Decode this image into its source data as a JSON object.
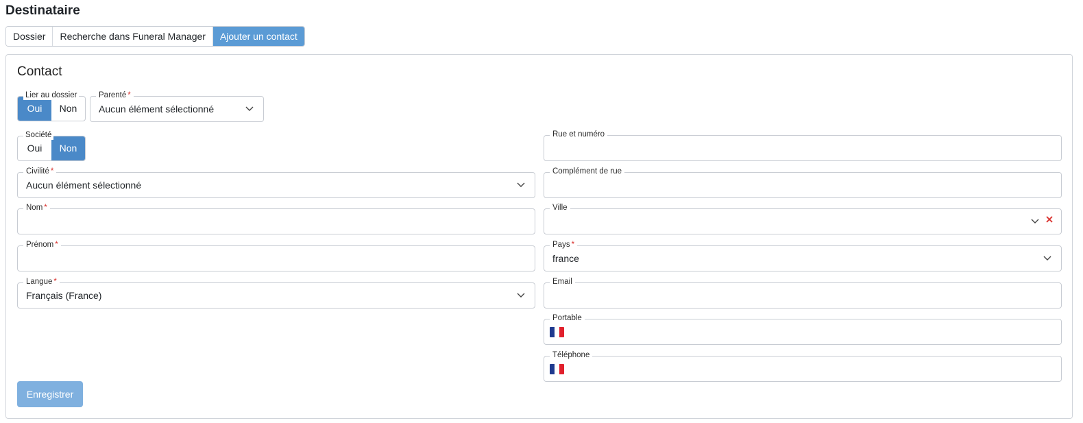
{
  "page": {
    "heading": "Destinataire"
  },
  "tabs": [
    {
      "label": "Dossier",
      "active": false
    },
    {
      "label": "Recherche dans Funeral Manager",
      "active": false
    },
    {
      "label": "Ajouter un contact",
      "active": true
    }
  ],
  "contact": {
    "title": "Contact",
    "lier_au_dossier": {
      "label": "Lier au dossier",
      "options": [
        "Oui",
        "Non"
      ],
      "selected": "Oui"
    },
    "parente": {
      "label": "Parenté",
      "required": true,
      "value": "Aucun élément sélectionné"
    },
    "societe": {
      "label": "Société",
      "options": [
        "Oui",
        "Non"
      ],
      "selected": "Non"
    },
    "civilite": {
      "label": "Civilité",
      "required": true,
      "value": "Aucun élément sélectionné"
    },
    "nom": {
      "label": "Nom",
      "required": true,
      "value": ""
    },
    "prenom": {
      "label": "Prénom",
      "required": true,
      "value": ""
    },
    "langue": {
      "label": "Langue",
      "required": true,
      "value": "Français (France)"
    },
    "rue": {
      "label": "Rue et numéro",
      "value": ""
    },
    "complement": {
      "label": "Complément de rue",
      "value": ""
    },
    "ville": {
      "label": "Ville",
      "value": ""
    },
    "pays": {
      "label": "Pays",
      "required": true,
      "value": "france"
    },
    "email": {
      "label": "Email",
      "value": ""
    },
    "portable": {
      "label": "Portable",
      "value": "",
      "flag": "fr-flag-icon"
    },
    "telephone": {
      "label": "Téléphone",
      "value": "",
      "flag": "fr-flag-icon"
    },
    "save_label": "Enregistrer",
    "required_marker": "*"
  },
  "colors": {
    "accent": "#4a89c8",
    "tab_active": "#5b9bd5",
    "save_button": "#7fb0df",
    "required": "#d9302c",
    "clear": "#d9302c"
  }
}
